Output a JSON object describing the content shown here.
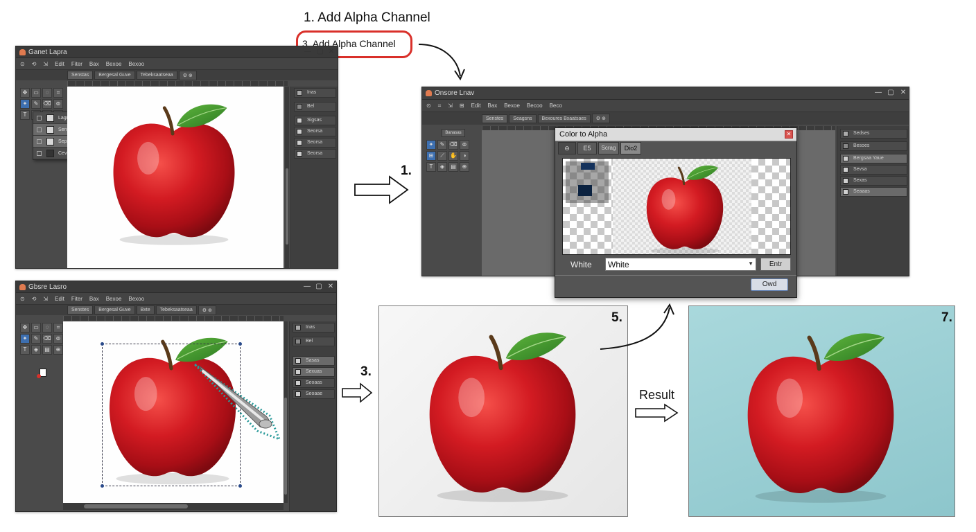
{
  "top_title": "1. Add Alpha Channel",
  "callout_text": "3. Add Alpha Channel",
  "steps": {
    "s1": "1.",
    "s3": "3.",
    "s5": "5.",
    "s7": "7.",
    "result": "Result"
  },
  "win1": {
    "title": "Ganet Lapra",
    "menu": [
      "Edit",
      "Fiter",
      "Bax",
      "Bexoe",
      "Bexoo"
    ],
    "tabs": [
      "Senstas",
      "Bergesal Guve",
      "Tebeksaatseaa"
    ],
    "dock_top": "Inas",
    "dock_select": "Bel",
    "dock_rows": [
      "Sigsas",
      "Seorsa",
      "Seorsa",
      "Seorsa"
    ],
    "context_menu": [
      "Lagne",
      "Sents",
      "Sepsa",
      "Cevskee"
    ]
  },
  "win2": {
    "title": "Onsore Lnav",
    "menu": [
      "Edit",
      "Bax",
      "Bexoe",
      "Becoo",
      "Beco"
    ],
    "tabs": [
      "Senstes",
      "Seagsns",
      "Bexoures Bxaatsaes"
    ],
    "dock_top": "Sedses",
    "dock_select": "Besoes",
    "dock_rows": [
      "Bergsaa Yaue",
      "Sevsa",
      "Sexas",
      "Seaaas"
    ],
    "toolbox_label": "Banasas"
  },
  "dialog": {
    "title": "Color to Alpha",
    "tabs": [
      "E5",
      "Scrag",
      "Dio2"
    ],
    "color_label": "White",
    "color_value": "White",
    "side_button": "Entr",
    "ok_button": "Owd"
  },
  "win3": {
    "title": "Gbsre Lasro",
    "menu": [
      "Edit",
      "Fiter",
      "Bax",
      "Bexoe",
      "Bexoo"
    ],
    "tabs": [
      "Senstes",
      "Bergesal Guve",
      "Bxte",
      "Tebeksaatseaa"
    ],
    "dock_top": "Inas",
    "dock_select": "Bel",
    "dock_rows": [
      "Sasas",
      "Sexuas",
      "Seoaas",
      "Seoaae"
    ]
  },
  "colors": {
    "callout_border": "#d9302a",
    "apple_red": "#c8161d",
    "leaf_green": "#3a8a2a",
    "teal_background": "#9ccfd4"
  }
}
